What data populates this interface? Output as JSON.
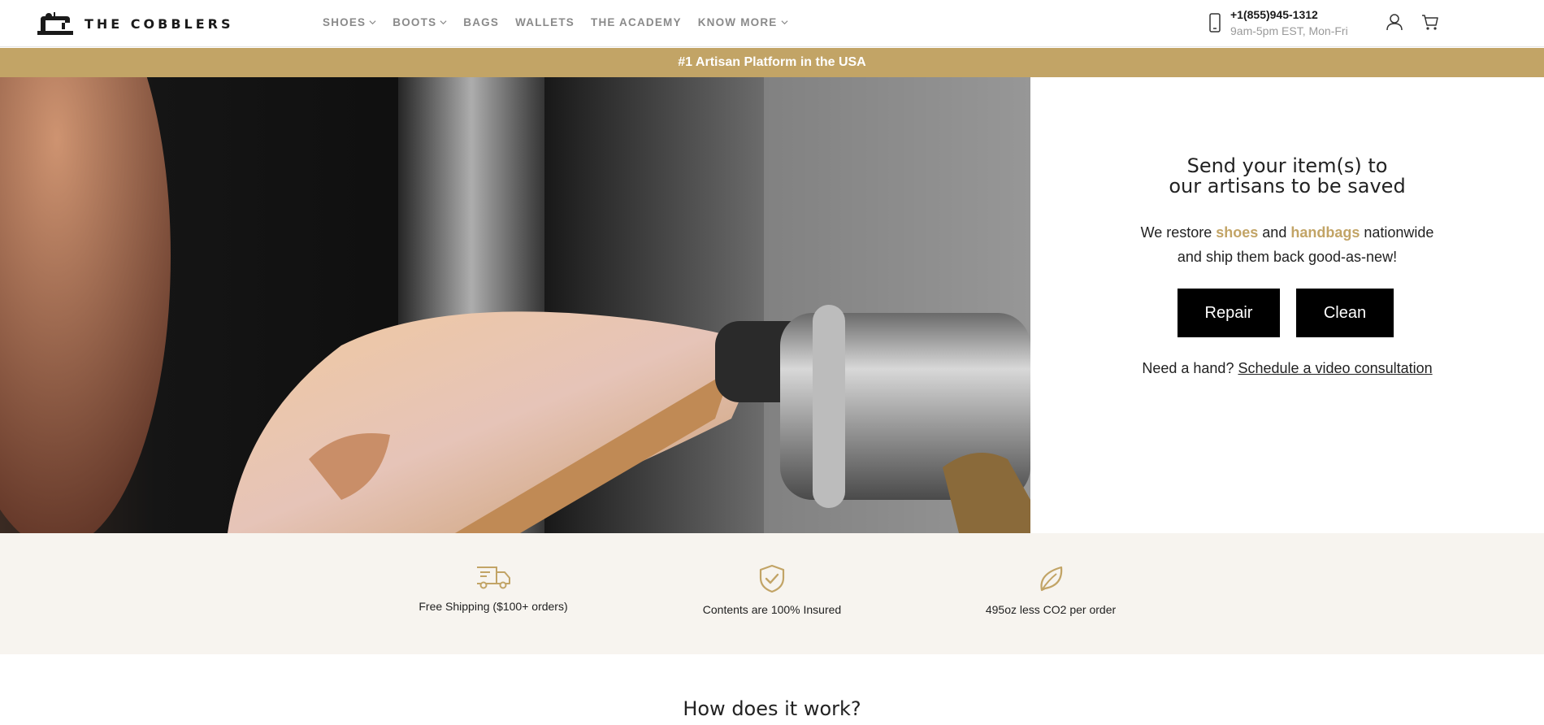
{
  "brand": {
    "name": "THE COBBLERS"
  },
  "nav": [
    {
      "label": "SHOES",
      "has_dropdown": true
    },
    {
      "label": "BOOTS",
      "has_dropdown": true
    },
    {
      "label": "BAGS",
      "has_dropdown": false
    },
    {
      "label": "WALLETS",
      "has_dropdown": false
    },
    {
      "label": "THE ACADEMY",
      "has_dropdown": false
    },
    {
      "label": "KNOW MORE",
      "has_dropdown": true
    }
  ],
  "contact": {
    "phone": "+1(855)945-1312",
    "hours": "9am-5pm EST, Mon-Fri"
  },
  "icons": {
    "phone": "phone-icon",
    "account": "user-icon",
    "cart": "cart-icon"
  },
  "banner": {
    "text": "#1 Artisan Platform in the USA"
  },
  "hero": {
    "title_line1": "Send your item(s) to",
    "title_line2": "our artisans to be saved",
    "desc_prefix": "We restore ",
    "desc_hl1": "shoes",
    "desc_and": " and ",
    "desc_hl2": "handbags",
    "desc_suffix": " nationwide",
    "desc_line2": "and ship them back good-as-new!",
    "repair_label": "Repair",
    "clean_label": "Clean",
    "help_prefix": "Need a hand? ",
    "help_link": "Schedule a video consultation"
  },
  "features": [
    {
      "icon": "truck-icon",
      "label": "Free Shipping ($100+ orders)"
    },
    {
      "icon": "shield-check-icon",
      "label": "Contents are 100% Insured"
    },
    {
      "icon": "leaf-icon",
      "label": "495oz less CO2 per order"
    }
  ],
  "how": {
    "title": "How does it work?"
  },
  "colors": {
    "accent": "#c2a466",
    "feature_bg": "#f7f4ef",
    "button_bg": "#000000"
  }
}
